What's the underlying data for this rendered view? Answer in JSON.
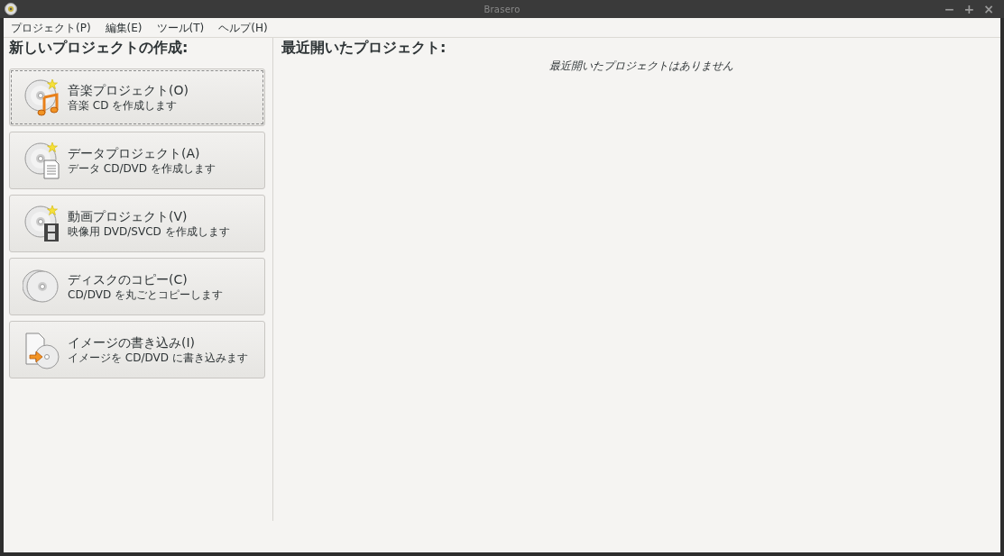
{
  "window": {
    "title": "Brasero",
    "controls": [
      "−",
      "+",
      "×"
    ]
  },
  "menu": [
    "プロジェクト(P)",
    "編集(E)",
    "ツール(T)",
    "ヘルプ(H)"
  ],
  "new_project": {
    "heading": "新しいプロジェクトの作成:",
    "buttons": [
      {
        "kind": "audio",
        "title": "音楽プロジェクト(O)",
        "subtitle": "音楽 CD を作成します",
        "focused": true
      },
      {
        "kind": "data",
        "title": "データプロジェクト(A)",
        "subtitle": "データ CD/DVD を作成します",
        "focused": false
      },
      {
        "kind": "video",
        "title": "動画プロジェクト(V)",
        "subtitle": "映像用 DVD/SVCD を作成します",
        "focused": false
      },
      {
        "kind": "copy",
        "title": "ディスクのコピー(C)",
        "subtitle": "CD/DVD を丸ごとコピーします",
        "focused": false
      },
      {
        "kind": "image",
        "title": "イメージの書き込み(I)",
        "subtitle": "イメージを CD/DVD に書き込みます",
        "focused": false
      }
    ]
  },
  "recent": {
    "heading": "最近開いたプロジェクト:",
    "empty_message": "最近開いたプロジェクトはありません"
  }
}
